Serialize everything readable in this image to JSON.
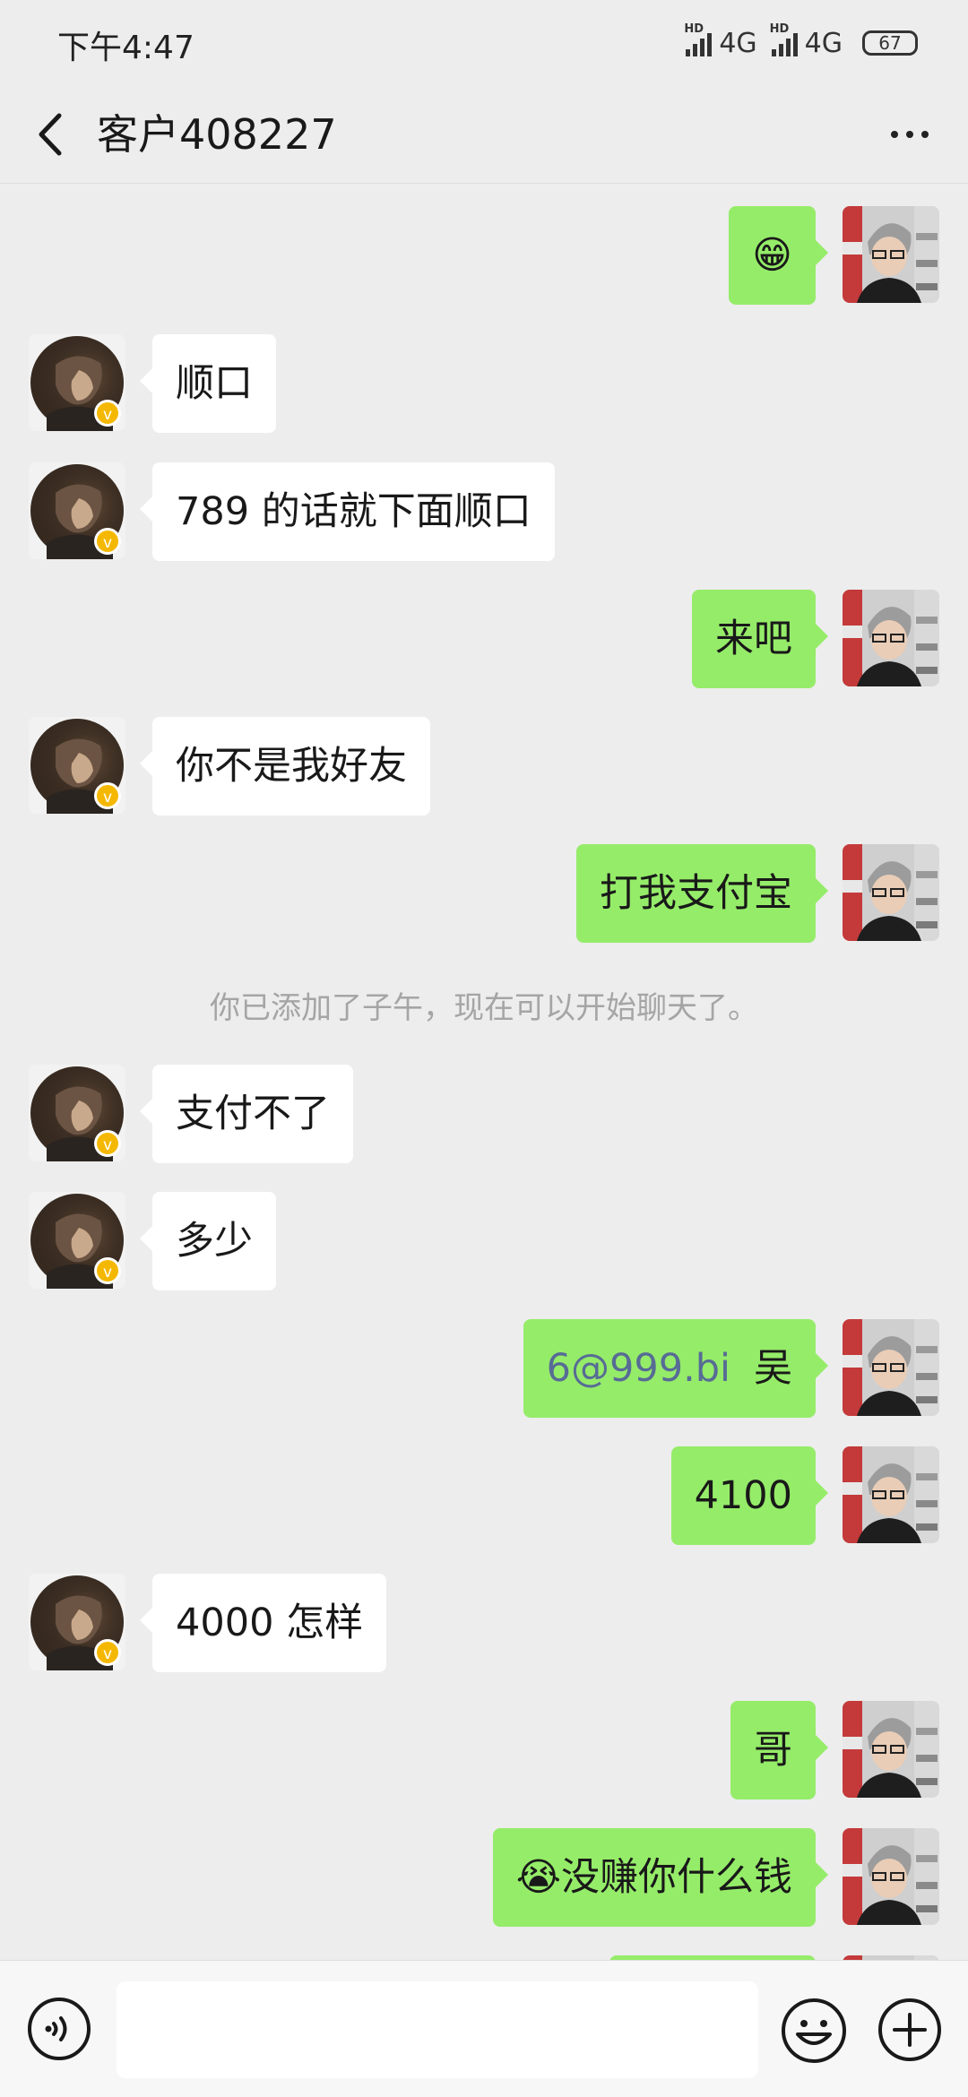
{
  "status_bar": {
    "time": "下午4:47",
    "signal1_label": "4G",
    "signal2_label": "4G",
    "hd_label": "HD",
    "battery": "67"
  },
  "header": {
    "title": "客户408227",
    "back_icon": "chevron-left-icon",
    "more_icon": "more-dots-icon"
  },
  "messages": [
    {
      "dir": "out",
      "text": "😁"
    },
    {
      "dir": "in",
      "text": "顺口"
    },
    {
      "dir": "in",
      "text": "789 的话就下面顺口"
    },
    {
      "dir": "out",
      "text": "来吧"
    },
    {
      "dir": "in",
      "text": "你不是我好友"
    },
    {
      "dir": "out",
      "text": "打我支付宝"
    },
    {
      "dir": "system",
      "text": "你已添加了子午，现在可以开始聊天了。"
    },
    {
      "dir": "in",
      "text": "支付不了"
    },
    {
      "dir": "in",
      "text": "多少"
    },
    {
      "dir": "out",
      "email": "6@999.bi",
      "text": "吴"
    },
    {
      "dir": "out",
      "text": "4100"
    },
    {
      "dir": "in",
      "text": "4000 怎样"
    },
    {
      "dir": "out",
      "text": "哥"
    },
    {
      "dir": "out",
      "text": "😭没赚你什么钱"
    }
  ],
  "input_bar": {
    "placeholder": "",
    "voice_icon": "voice-icon",
    "emoji_icon": "emoji-icon",
    "plus_icon": "plus-icon"
  },
  "colors": {
    "background": "#ededed",
    "bubble_out": "#95ec69",
    "bubble_in": "#ffffff",
    "link": "#576b95"
  }
}
